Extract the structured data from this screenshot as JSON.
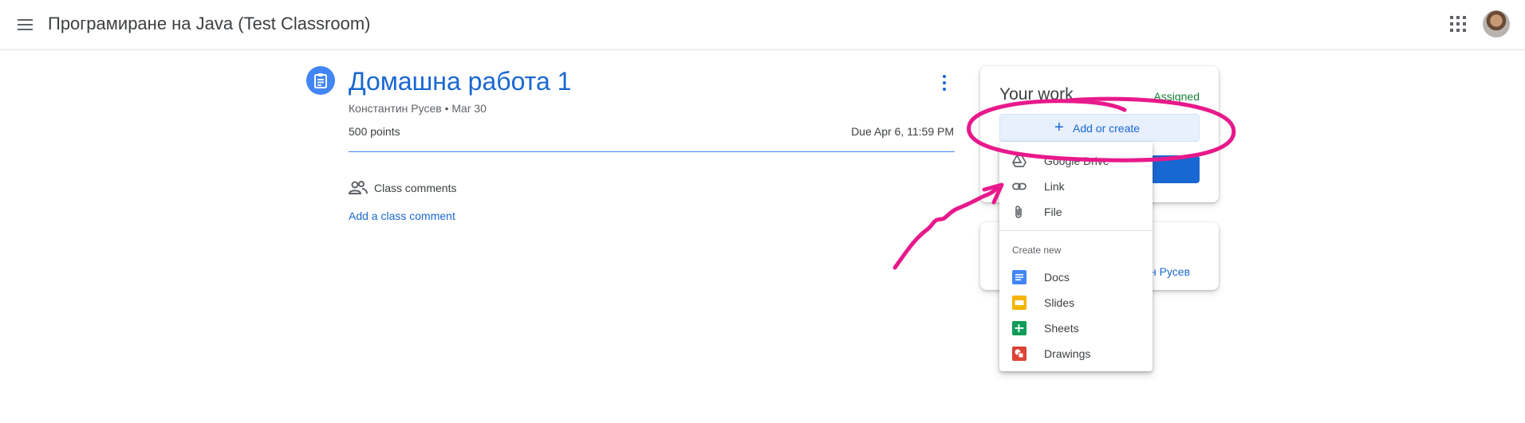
{
  "header": {
    "class_title": "Програмиране на Java (Test Classroom)"
  },
  "assignment": {
    "title": "Домашна работа 1",
    "meta": "Константин Русев • Mar 30",
    "points": "500 points",
    "due": "Due Apr 6, 11:59 PM"
  },
  "comments": {
    "label": "Class comments",
    "add_link": "Add a class comment"
  },
  "your_work": {
    "title": "Your work",
    "status": "Assigned",
    "add_create_label": "Add or create"
  },
  "private_comments": {
    "link_fragment": "н Русев"
  },
  "add_menu": {
    "attach_items": [
      {
        "label": "Google Drive",
        "icon": "google-drive-icon"
      },
      {
        "label": "Link",
        "icon": "link-icon"
      },
      {
        "label": "File",
        "icon": "paperclip-icon"
      }
    ],
    "create_heading": "Create new",
    "create_items": [
      {
        "label": "Docs",
        "icon": "docs-icon",
        "color": "#4285f4"
      },
      {
        "label": "Slides",
        "icon": "slides-icon",
        "color": "#f4b400"
      },
      {
        "label": "Sheets",
        "icon": "sheets-icon",
        "color": "#0f9d58"
      },
      {
        "label": "Drawings",
        "icon": "drawings-icon",
        "color": "#db4437"
      }
    ]
  },
  "colors": {
    "brand_blue": "#1967d2",
    "accent_blue": "#4285f4",
    "assigned_green": "#188038",
    "annotation_magenta": "#e8198b"
  }
}
